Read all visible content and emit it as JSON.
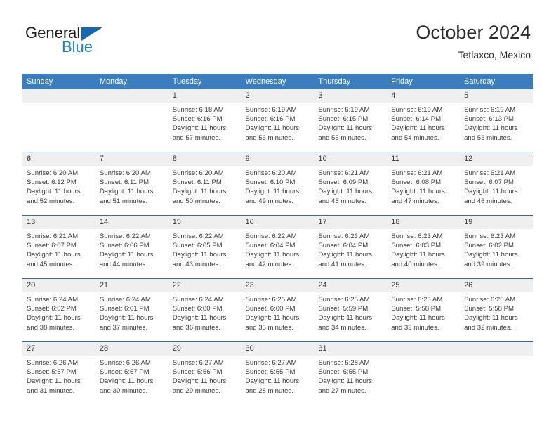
{
  "brand": {
    "name_part1": "General",
    "name_part2": "Blue",
    "triangle_icon": "triangle-icon",
    "accent_color": "#1668b0",
    "blue_text_color": "#1f7fc4"
  },
  "header": {
    "title": "October 2024",
    "subtitle": "Tetlaxco, Mexico"
  },
  "theme": {
    "header_row_bg": "#3b7dbd",
    "daynum_bg": "#efeff0",
    "row_divider": "#2f6fad",
    "text_color": "#3a3a3a"
  },
  "weekdays": [
    "Sunday",
    "Monday",
    "Tuesday",
    "Wednesday",
    "Thursday",
    "Friday",
    "Saturday"
  ],
  "labels": {
    "sunrise_prefix": "Sunrise:",
    "sunset_prefix": "Sunset:",
    "daylight_prefix": "Daylight:"
  },
  "weeks": [
    [
      {
        "day": "",
        "blank": true
      },
      {
        "day": "",
        "blank": true
      },
      {
        "day": "1",
        "sunrise": "Sunrise: 6:18 AM",
        "sunset": "Sunset: 6:16 PM",
        "daylight": "Daylight: 11 hours and 57 minutes."
      },
      {
        "day": "2",
        "sunrise": "Sunrise: 6:19 AM",
        "sunset": "Sunset: 6:16 PM",
        "daylight": "Daylight: 11 hours and 56 minutes."
      },
      {
        "day": "3",
        "sunrise": "Sunrise: 6:19 AM",
        "sunset": "Sunset: 6:15 PM",
        "daylight": "Daylight: 11 hours and 55 minutes."
      },
      {
        "day": "4",
        "sunrise": "Sunrise: 6:19 AM",
        "sunset": "Sunset: 6:14 PM",
        "daylight": "Daylight: 11 hours and 54 minutes."
      },
      {
        "day": "5",
        "sunrise": "Sunrise: 6:19 AM",
        "sunset": "Sunset: 6:13 PM",
        "daylight": "Daylight: 11 hours and 53 minutes."
      }
    ],
    [
      {
        "day": "6",
        "sunrise": "Sunrise: 6:20 AM",
        "sunset": "Sunset: 6:12 PM",
        "daylight": "Daylight: 11 hours and 52 minutes."
      },
      {
        "day": "7",
        "sunrise": "Sunrise: 6:20 AM",
        "sunset": "Sunset: 6:11 PM",
        "daylight": "Daylight: 11 hours and 51 minutes."
      },
      {
        "day": "8",
        "sunrise": "Sunrise: 6:20 AM",
        "sunset": "Sunset: 6:11 PM",
        "daylight": "Daylight: 11 hours and 50 minutes."
      },
      {
        "day": "9",
        "sunrise": "Sunrise: 6:20 AM",
        "sunset": "Sunset: 6:10 PM",
        "daylight": "Daylight: 11 hours and 49 minutes."
      },
      {
        "day": "10",
        "sunrise": "Sunrise: 6:21 AM",
        "sunset": "Sunset: 6:09 PM",
        "daylight": "Daylight: 11 hours and 48 minutes."
      },
      {
        "day": "11",
        "sunrise": "Sunrise: 6:21 AM",
        "sunset": "Sunset: 6:08 PM",
        "daylight": "Daylight: 11 hours and 47 minutes."
      },
      {
        "day": "12",
        "sunrise": "Sunrise: 6:21 AM",
        "sunset": "Sunset: 6:07 PM",
        "daylight": "Daylight: 11 hours and 46 minutes."
      }
    ],
    [
      {
        "day": "13",
        "sunrise": "Sunrise: 6:21 AM",
        "sunset": "Sunset: 6:07 PM",
        "daylight": "Daylight: 11 hours and 45 minutes."
      },
      {
        "day": "14",
        "sunrise": "Sunrise: 6:22 AM",
        "sunset": "Sunset: 6:06 PM",
        "daylight": "Daylight: 11 hours and 44 minutes."
      },
      {
        "day": "15",
        "sunrise": "Sunrise: 6:22 AM",
        "sunset": "Sunset: 6:05 PM",
        "daylight": "Daylight: 11 hours and 43 minutes."
      },
      {
        "day": "16",
        "sunrise": "Sunrise: 6:22 AM",
        "sunset": "Sunset: 6:04 PM",
        "daylight": "Daylight: 11 hours and 42 minutes."
      },
      {
        "day": "17",
        "sunrise": "Sunrise: 6:23 AM",
        "sunset": "Sunset: 6:04 PM",
        "daylight": "Daylight: 11 hours and 41 minutes."
      },
      {
        "day": "18",
        "sunrise": "Sunrise: 6:23 AM",
        "sunset": "Sunset: 6:03 PM",
        "daylight": "Daylight: 11 hours and 40 minutes."
      },
      {
        "day": "19",
        "sunrise": "Sunrise: 6:23 AM",
        "sunset": "Sunset: 6:02 PM",
        "daylight": "Daylight: 11 hours and 39 minutes."
      }
    ],
    [
      {
        "day": "20",
        "sunrise": "Sunrise: 6:24 AM",
        "sunset": "Sunset: 6:02 PM",
        "daylight": "Daylight: 11 hours and 38 minutes."
      },
      {
        "day": "21",
        "sunrise": "Sunrise: 6:24 AM",
        "sunset": "Sunset: 6:01 PM",
        "daylight": "Daylight: 11 hours and 37 minutes."
      },
      {
        "day": "22",
        "sunrise": "Sunrise: 6:24 AM",
        "sunset": "Sunset: 6:00 PM",
        "daylight": "Daylight: 11 hours and 36 minutes."
      },
      {
        "day": "23",
        "sunrise": "Sunrise: 6:25 AM",
        "sunset": "Sunset: 6:00 PM",
        "daylight": "Daylight: 11 hours and 35 minutes."
      },
      {
        "day": "24",
        "sunrise": "Sunrise: 6:25 AM",
        "sunset": "Sunset: 5:59 PM",
        "daylight": "Daylight: 11 hours and 34 minutes."
      },
      {
        "day": "25",
        "sunrise": "Sunrise: 6:25 AM",
        "sunset": "Sunset: 5:58 PM",
        "daylight": "Daylight: 11 hours and 33 minutes."
      },
      {
        "day": "26",
        "sunrise": "Sunrise: 6:26 AM",
        "sunset": "Sunset: 5:58 PM",
        "daylight": "Daylight: 11 hours and 32 minutes."
      }
    ],
    [
      {
        "day": "27",
        "sunrise": "Sunrise: 6:26 AM",
        "sunset": "Sunset: 5:57 PM",
        "daylight": "Daylight: 11 hours and 31 minutes."
      },
      {
        "day": "28",
        "sunrise": "Sunrise: 6:26 AM",
        "sunset": "Sunset: 5:57 PM",
        "daylight": "Daylight: 11 hours and 30 minutes."
      },
      {
        "day": "29",
        "sunrise": "Sunrise: 6:27 AM",
        "sunset": "Sunset: 5:56 PM",
        "daylight": "Daylight: 11 hours and 29 minutes."
      },
      {
        "day": "30",
        "sunrise": "Sunrise: 6:27 AM",
        "sunset": "Sunset: 5:55 PM",
        "daylight": "Daylight: 11 hours and 28 minutes."
      },
      {
        "day": "31",
        "sunrise": "Sunrise: 6:28 AM",
        "sunset": "Sunset: 5:55 PM",
        "daylight": "Daylight: 11 hours and 27 minutes."
      },
      {
        "day": "",
        "blank": true
      },
      {
        "day": "",
        "blank": true
      }
    ]
  ]
}
